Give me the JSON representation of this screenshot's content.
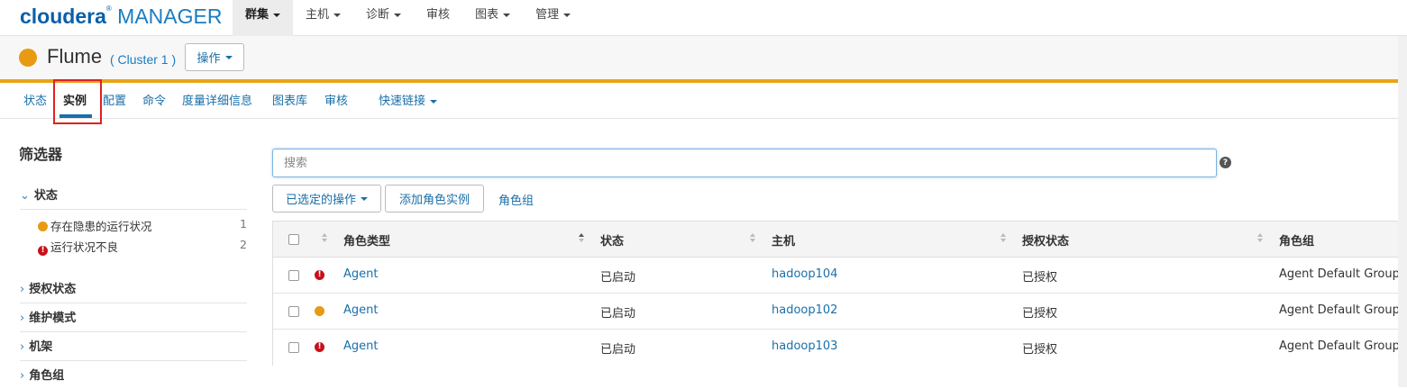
{
  "logo": {
    "brand": "cloudera",
    "reg": "®",
    "product": "MANAGER"
  },
  "topnav": [
    {
      "label": "群集",
      "caret": true,
      "active": true
    },
    {
      "label": "主机",
      "caret": true
    },
    {
      "label": "诊断",
      "caret": true
    },
    {
      "label": "审核",
      "caret": false
    },
    {
      "label": "图表",
      "caret": true
    },
    {
      "label": "管理",
      "caret": true
    }
  ],
  "service": {
    "name": "Flume",
    "cluster": "( Cluster 1 )",
    "status_color": "#e89a12",
    "actions_label": "操作"
  },
  "subnav": [
    {
      "label": "状态"
    },
    {
      "label": "实例",
      "active": true
    },
    {
      "label": "配置"
    },
    {
      "label": "命令"
    },
    {
      "label": "度量详细信息"
    },
    {
      "label": "图表库"
    },
    {
      "label": "审核"
    },
    {
      "label": "快速链接",
      "caret": true
    }
  ],
  "filters": {
    "title": "筛选器",
    "status": {
      "label": "状态",
      "items": [
        {
          "label": "存在隐患的运行状况",
          "count": "1",
          "icon": "warning-dot"
        },
        {
          "label": "运行状况不良",
          "count": "2",
          "icon": "error-icon"
        }
      ]
    },
    "collapsed": [
      "授权状态",
      "维护模式",
      "机架",
      "角色组"
    ]
  },
  "search": {
    "placeholder": "搜索",
    "value": ""
  },
  "toolbar": {
    "selected_actions": "已选定的操作",
    "add_role": "添加角色实例",
    "role_groups": "角色组"
  },
  "table": {
    "columns": [
      "角色类型",
      "状态",
      "主机",
      "授权状态",
      "角色组"
    ],
    "rows": [
      {
        "health": "bad",
        "role_type": "Agent",
        "status": "已启动",
        "host": "hadoop104",
        "license": "已授权",
        "role_group": "Agent Default Group"
      },
      {
        "health": "concerning",
        "role_type": "Agent",
        "status": "已启动",
        "host": "hadoop102",
        "license": "已授权",
        "role_group": "Agent Default Group"
      },
      {
        "health": "bad",
        "role_type": "Agent",
        "status": "已启动",
        "host": "hadoop103",
        "license": "已授权",
        "role_group": "Agent Default Group"
      }
    ]
  },
  "colors": {
    "accent": "#1a6fa9",
    "warning": "#e89a12",
    "error": "#c8101a",
    "service_bar": "#e8a415",
    "highlight_box": "#e02020"
  }
}
